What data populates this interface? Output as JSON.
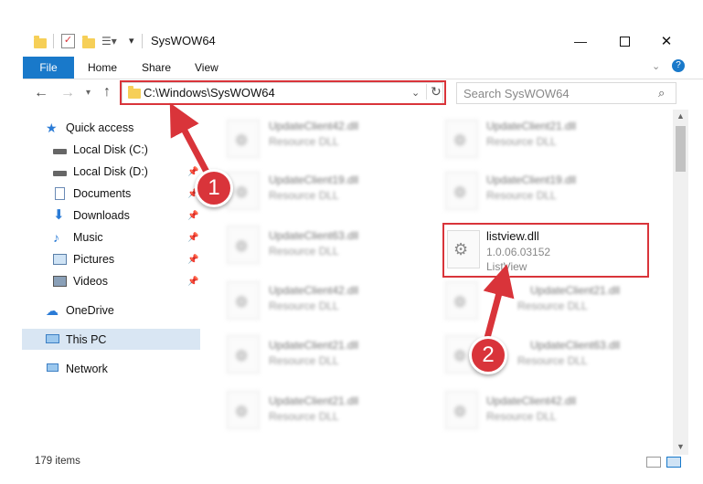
{
  "window": {
    "title": "SysWOW64"
  },
  "ribbon": {
    "tabs": [
      "File",
      "Home",
      "Share",
      "View"
    ]
  },
  "toolbar": {
    "address": "C:\\Windows\\SysWOW64",
    "search_placeholder": "Search SysWOW64"
  },
  "sidebar": {
    "items": [
      {
        "label": "Quick access"
      },
      {
        "label": "Local Disk (C:)"
      },
      {
        "label": "Local Disk (D:)"
      },
      {
        "label": "Documents"
      },
      {
        "label": "Downloads"
      },
      {
        "label": "Music"
      },
      {
        "label": "Pictures"
      },
      {
        "label": "Videos"
      },
      {
        "label": "OneDrive"
      },
      {
        "label": "This PC"
      },
      {
        "label": "Network"
      }
    ]
  },
  "files": {
    "left": [
      {
        "name": "UpdateClient42.dll",
        "sub": "Resource DLL"
      },
      {
        "name": "UpdateClient19.dll",
        "sub": "Resource DLL"
      },
      {
        "name": "UpdateClient63.dll",
        "sub": "Resource DLL"
      },
      {
        "name": "UpdateClient42.dll",
        "sub": "Resource DLL"
      },
      {
        "name": "UpdateClient21.dll",
        "sub": "Resource DLL"
      },
      {
        "name": "UpdateClient21.dll",
        "sub": "Resource DLL"
      }
    ],
    "right": [
      {
        "name": "UpdateClient21.dll",
        "sub": "Resource DLL"
      },
      {
        "name": "UpdateClient19.dll",
        "sub": "Resource DLL"
      },
      {
        "name": "UpdateClient21.dll",
        "sub": "Resource DLL"
      },
      {
        "name": "UpdateClient63.dll",
        "sub": "Resource DLL"
      },
      {
        "name": "UpdateClient42.dll",
        "sub": "Resource DLL"
      }
    ],
    "highlighted": {
      "name": "listview.dll",
      "version": "1.0.06.03152",
      "description": "ListView"
    }
  },
  "status": {
    "item_count": "179 items"
  },
  "annotations": {
    "step1": "1",
    "step2": "2"
  },
  "colors": {
    "accent": "#1979ca",
    "highlight": "#d9343a",
    "selection": "#d9e6f3"
  }
}
